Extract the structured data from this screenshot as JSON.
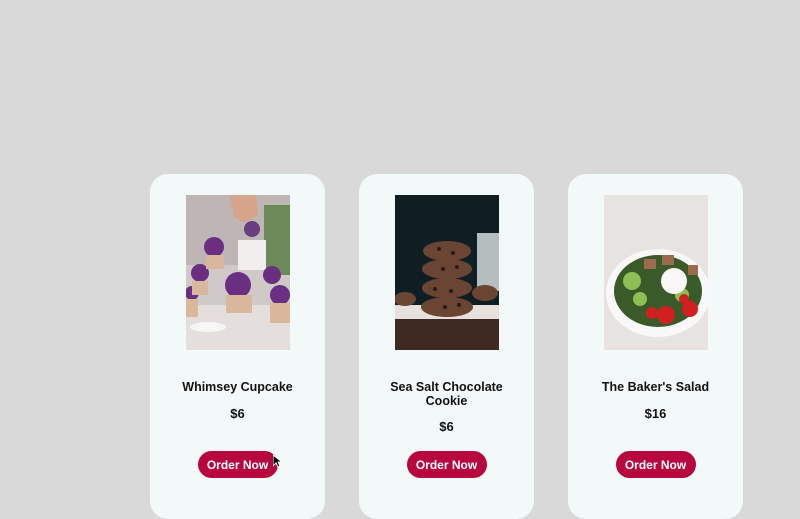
{
  "products": [
    {
      "name": "Whimsey Cupcake",
      "price": "$6",
      "button": "Order Now",
      "image": "cupcake-photo"
    },
    {
      "name": "Sea Salt Chocolate Cookie",
      "price": "$6",
      "button": "Order Now",
      "image": "cookie-photo"
    },
    {
      "name": "The Baker's Salad",
      "price": "$16",
      "button": "Order Now",
      "image": "salad-photo"
    }
  ],
  "colors": {
    "background": "#d9d9d9",
    "card": "#f3f9f9",
    "button": "#b8073f",
    "button_text": "#ffffff"
  }
}
